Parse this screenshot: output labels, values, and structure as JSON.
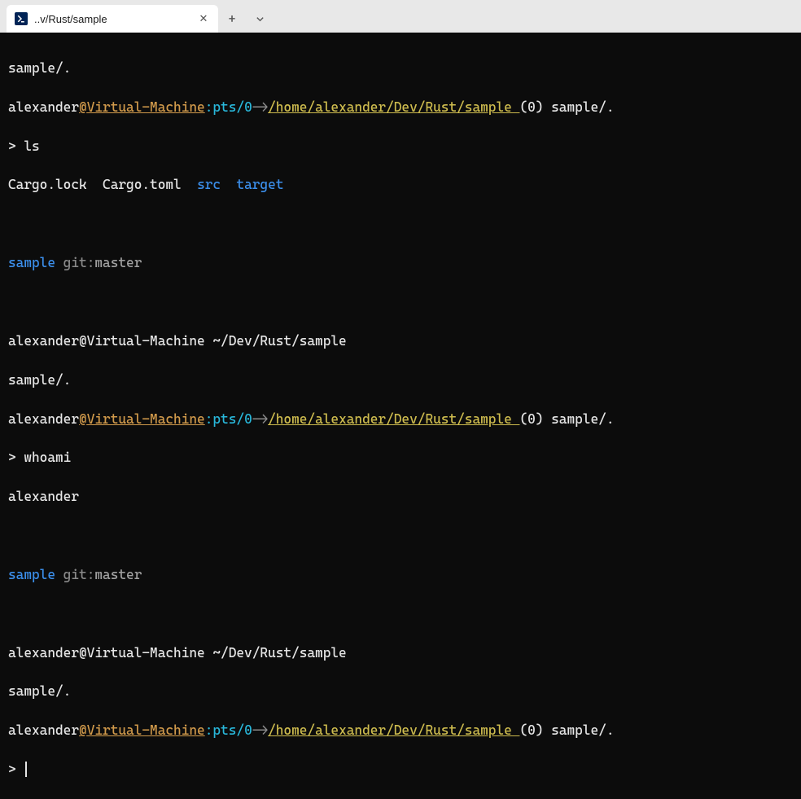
{
  "tab": {
    "title": "..v/Rust/sample",
    "icon_glyph": "❯_"
  },
  "prompt": {
    "user": "alexander",
    "at": "@",
    "host": "Virtual-Machine",
    "colon": ":",
    "tty": "pts/0",
    "arrow": "->",
    "path": "/home/alexander/Dev/Rust/sample ",
    "open_paren": "(",
    "gitnum": "0",
    "close_paren": ")",
    "trail": " sample/.",
    "chev": "> "
  },
  "context_line": "sample/.",
  "dir_summary": {
    "folder": "sample",
    "git_label": " git:",
    "branch": "master"
  },
  "alt_prompt": "alexander@Virtual-Machine ~/Dev/Rust/sample",
  "cmd1": "ls",
  "ls_output": {
    "f1": "Cargo.lock",
    "f2": "Cargo.toml",
    "d1": "src",
    "d2": "target"
  },
  "cmd2": "whoami",
  "whoami_output": "alexander",
  "blank": " "
}
